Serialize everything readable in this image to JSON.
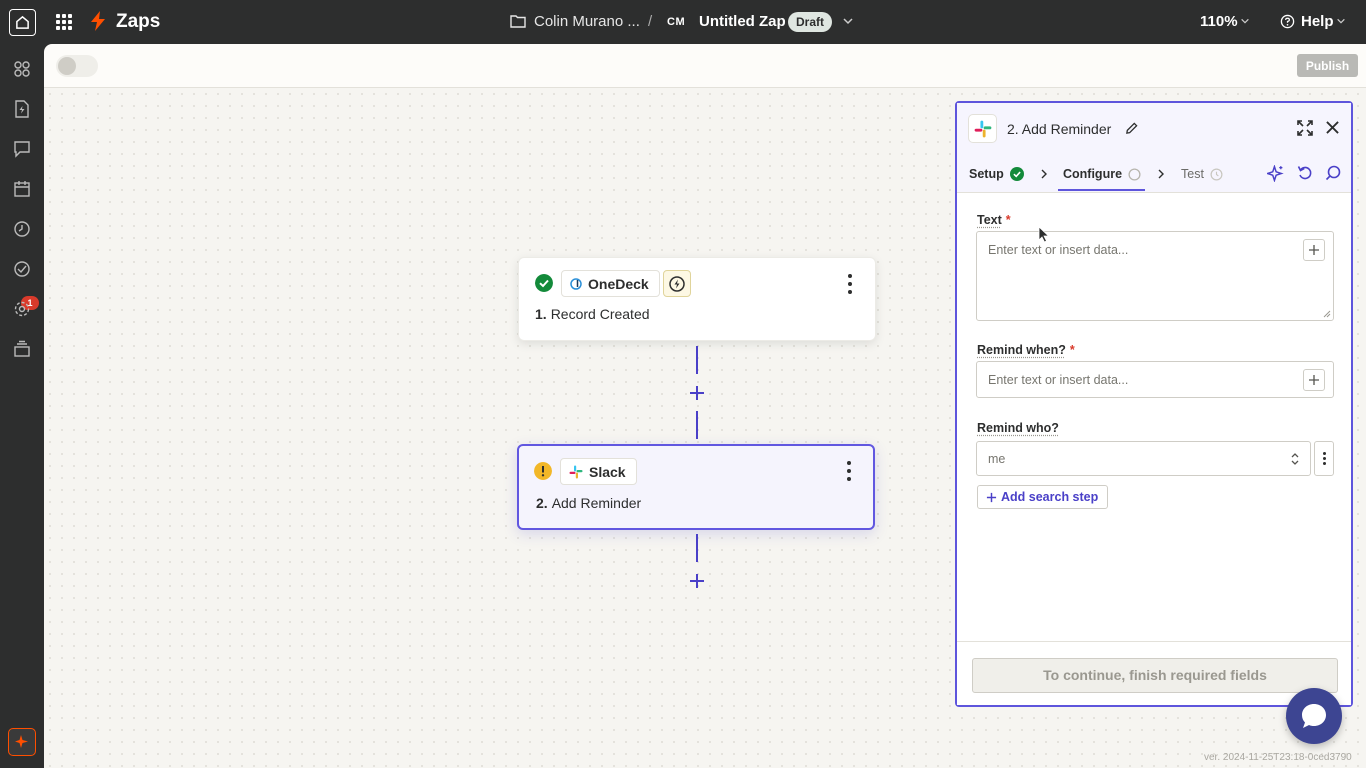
{
  "topbar": {
    "app_name": "Zaps",
    "breadcrumb_folder": "Colin Murano ...",
    "breadcrumb_separator": "/",
    "user_initials": "CM",
    "zap_title": "Untitled Zap",
    "status_badge": "Draft",
    "zoom": "110%",
    "help_label": "Help"
  },
  "rail": {
    "notification_count": "1"
  },
  "subbar": {
    "publish_label": "Publish"
  },
  "steps": [
    {
      "number": "1.",
      "app": "OneDeck",
      "title": "Record Created",
      "status": "complete",
      "status_color": "#138a3a"
    },
    {
      "number": "2.",
      "app": "Slack",
      "title": "Add Reminder",
      "status": "warning",
      "status_color": "#f2b728"
    }
  ],
  "panel": {
    "title": "2. Add Reminder",
    "tabs": {
      "setup": "Setup",
      "configure": "Configure",
      "test": "Test"
    },
    "fields": {
      "text_label": "Text",
      "text_placeholder": "Enter text or insert data...",
      "remind_when_label": "Remind when?",
      "remind_when_placeholder": "Enter text or insert data...",
      "remind_who_label": "Remind who?",
      "remind_who_value": "me",
      "required_mark": "*"
    },
    "add_search_step": "Add search step",
    "continue_label": "To continue, finish required fields"
  },
  "version": "ver. 2024-11-25T23:18-0ced3790",
  "colors": {
    "accent": "#5e55dc",
    "brand": "#ff4f00",
    "dark": "#2d2e2e"
  }
}
